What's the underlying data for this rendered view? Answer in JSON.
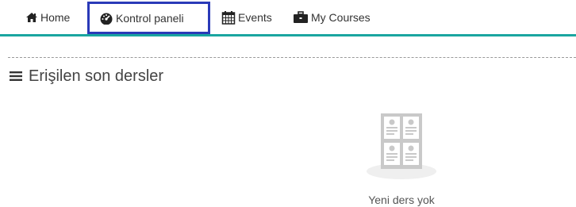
{
  "nav": {
    "home_label": "Home",
    "dashboard_label": "Kontrol paneli",
    "events_label": "Events",
    "courses_label": "My Courses",
    "accent_color": "#1aa5a0",
    "highlight_color": "#2a3ab8",
    "icons": [
      "home-icon",
      "dashboard-icon",
      "calendar-icon",
      "briefcase-icon"
    ]
  },
  "section": {
    "title": "Erişilen son dersler",
    "title_icon": "list-icon"
  },
  "empty_state": {
    "message": "Yeni ders yok",
    "icon": "courses-empty-icon"
  }
}
